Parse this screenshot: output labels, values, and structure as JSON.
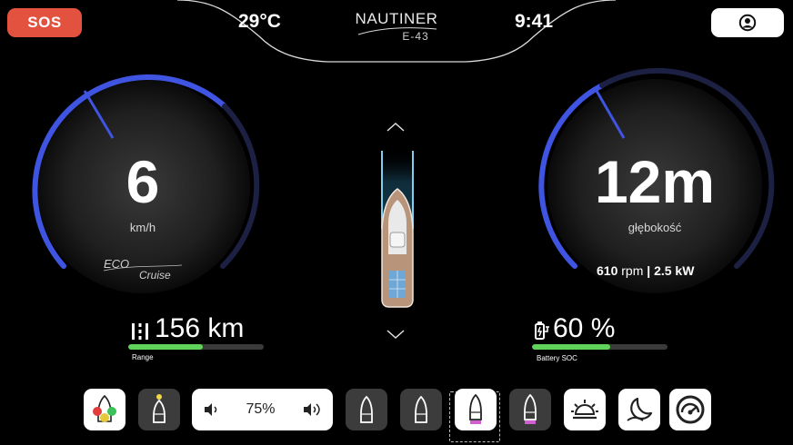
{
  "header": {
    "sos_label": "SOS",
    "temperature": "29°C",
    "brand": "NAUTINER",
    "model": "E-43",
    "time": "9:41",
    "user_icon": "user-circle-icon"
  },
  "speed_gauge": {
    "value": "6",
    "unit": "km/h",
    "mode_line1": "ECO",
    "mode_line2": "Cruise",
    "arc_color": "#3f54e0"
  },
  "depth_gauge": {
    "value": "12m",
    "unit": "głębokość",
    "rpm": "610",
    "rpm_unit": "rpm",
    "separator": "|",
    "power": "2.5 kW",
    "arc_color": "#3f54e0"
  },
  "range": {
    "value": "156 km",
    "label": "Range",
    "fill_fraction": 0.55,
    "icon": "distance-icon"
  },
  "battery": {
    "value": "60 %",
    "label": "Battery SOC",
    "fill_fraction": 0.58,
    "icon": "battery-plug-icon"
  },
  "boat": {
    "up_icon": "chevron-up-icon",
    "down_icon": "chevron-down-icon"
  },
  "controls": {
    "volume_value": "75%",
    "volume_down_icon": "volume-down-icon",
    "volume_up_icon": "volume-up-icon",
    "accent_color": "#d15fd0",
    "items": [
      "nav-lights-icon",
      "anchor-light-icon",
      "boat-icon",
      "boat-icon",
      "boat-underwater-light-icon",
      "boat-underwater-light-icon",
      "deck-light-icon",
      "night-mode-icon",
      "speedometer-icon"
    ]
  }
}
